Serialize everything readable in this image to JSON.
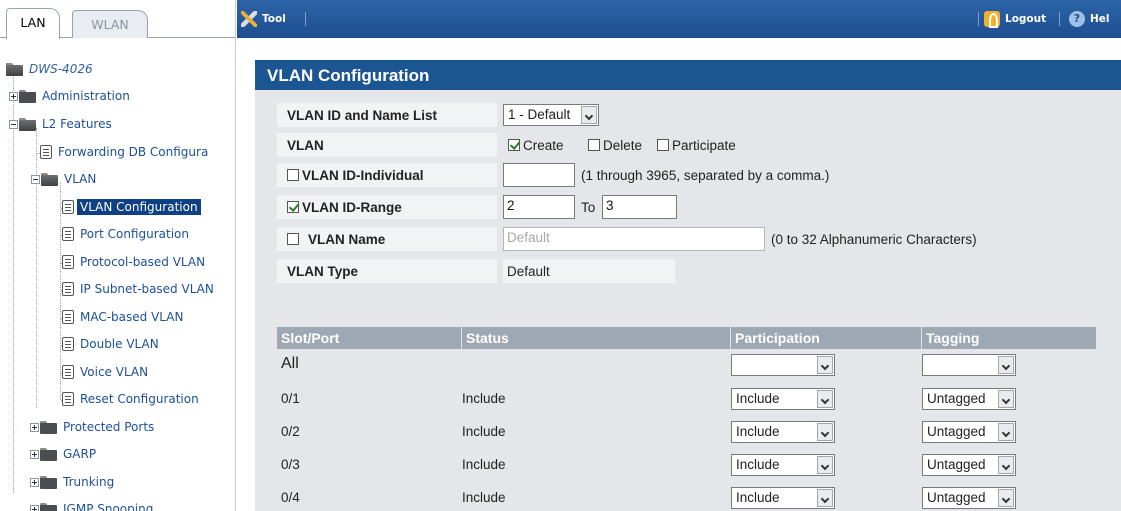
{
  "tabs": {
    "lan": "LAN",
    "wlan": "WLAN"
  },
  "tree": {
    "root": "DWS-4026",
    "administration": "Administration",
    "l2_features": "L2 Features",
    "forwarding_db": "Forwarding DB Configura",
    "vlan": "VLAN",
    "vlan_children": [
      "VLAN Configuration",
      "Port Configuration",
      "Protocol-based VLAN",
      "IP Subnet-based VLAN",
      "MAC-based VLAN",
      "Double VLAN",
      "Voice VLAN",
      "Reset Configuration"
    ],
    "protected_ports": "Protected Ports",
    "garp": "GARP",
    "trunking": "Trunking",
    "igmp_snooping": "IGMP Snooping"
  },
  "topbar": {
    "tool": "Tool",
    "logout": "Logout",
    "help": "Hel"
  },
  "panel": {
    "title": "VLAN Configuration"
  },
  "form": {
    "vlan_list_label": "VLAN ID and Name List",
    "vlan_list_value": "1 - Default",
    "vlan_label": "VLAN",
    "create": "Create",
    "delete": "Delete",
    "participate": "Participate",
    "id_individual_label": "VLAN ID-Individual",
    "id_individual_value": "",
    "id_individual_hint": "(1 through 3965, separated by a comma.)",
    "id_range_label": "VLAN ID-Range",
    "range_from": "2",
    "range_to_label": "To",
    "range_to": "3",
    "name_label": "VLAN Name",
    "name_value": "Default",
    "name_hint": "(0 to 32 Alphanumeric Characters)",
    "type_label": "VLAN Type",
    "type_value": "Default"
  },
  "ports_table": {
    "headers": [
      "Slot/Port",
      "Status",
      "Participation",
      "Tagging"
    ],
    "all_label": "All",
    "all_participation": "",
    "all_tagging": "",
    "rows": [
      {
        "port": "0/1",
        "status": "Include",
        "participation": "Include",
        "tagging": "Untagged"
      },
      {
        "port": "0/2",
        "status": "Include",
        "participation": "Include",
        "tagging": "Untagged"
      },
      {
        "port": "0/3",
        "status": "Include",
        "participation": "Include",
        "tagging": "Untagged"
      },
      {
        "port": "0/4",
        "status": "Include",
        "participation": "Include",
        "tagging": "Untagged"
      }
    ]
  },
  "colors": {
    "title_bar": "#1b5592",
    "top_bar": "#2d64a8",
    "selected_node": "#0f3f84",
    "table_header": "#9ea8b3"
  }
}
